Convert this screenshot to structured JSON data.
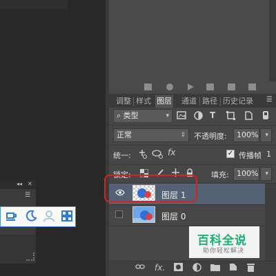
{
  "layers_panel": {
    "tabs": [
      {
        "label": "调整"
      },
      {
        "label": "样式"
      },
      {
        "label": "图层"
      },
      {
        "label": "通道"
      },
      {
        "label": "路径"
      },
      {
        "label": "历史记录"
      }
    ],
    "kind_filter": {
      "value": "类型"
    },
    "blend_mode": {
      "value": "正常"
    },
    "opacity": {
      "label": "不透明度:",
      "value": "100%"
    },
    "unify": {
      "label": "统一:"
    },
    "propagate": {
      "label": "传播帧",
      "value": "1",
      "checked": true
    },
    "lock": {
      "label": "锁定:"
    },
    "fill": {
      "label": "填充:",
      "value": "100%"
    },
    "layers": [
      {
        "name": "图层 1",
        "visible": true,
        "selected": true
      },
      {
        "name": "图层 0",
        "visible": false,
        "selected": false
      }
    ],
    "bottom_icons": [
      "link-icon",
      "fx-icon",
      "mask-icon",
      "adjustment-icon",
      "folder-icon",
      "new-layer-icon",
      "trash-icon"
    ],
    "selection_color": "#556275",
    "highlight_color": "#e02020"
  },
  "watermark": {
    "title": "百科全说",
    "subtitle": "助你轻松解决",
    "color": "#19b371"
  },
  "glyphs": {
    "chev": "▾",
    "menu": "☰",
    "collapse": "◂◂",
    "close": "✕",
    "search": "⌕",
    "eye": "👁",
    "check": "✓",
    "up_down": "⇕"
  }
}
